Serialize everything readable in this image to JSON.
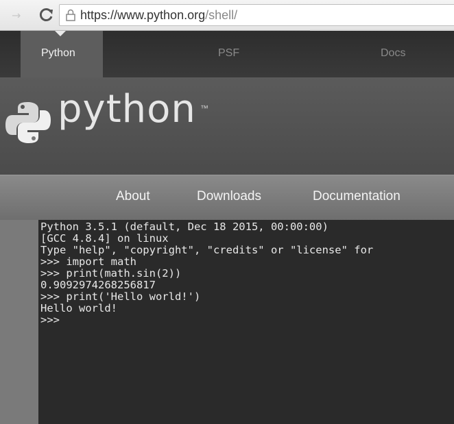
{
  "browser": {
    "url_host": "https://www.python.org",
    "url_path": "/shell/"
  },
  "topnav": {
    "tabs": [
      "Python",
      "PSF",
      "Docs"
    ]
  },
  "header": {
    "logo_text": "python",
    "trademark": "™"
  },
  "mainnav": {
    "items": [
      "About",
      "Downloads",
      "Documentation"
    ]
  },
  "shell": {
    "lines": [
      "Python 3.5.1 (default, Dec 18 2015, 00:00:00)",
      "[GCC 4.8.4] on linux",
      "Type \"help\", \"copyright\", \"credits\" or \"license\" for",
      ">>> import math",
      ">>> print(math.sin(2))",
      "0.9092974268256817",
      ">>> print('Hello world!')",
      "Hello world!",
      ">>>"
    ]
  }
}
